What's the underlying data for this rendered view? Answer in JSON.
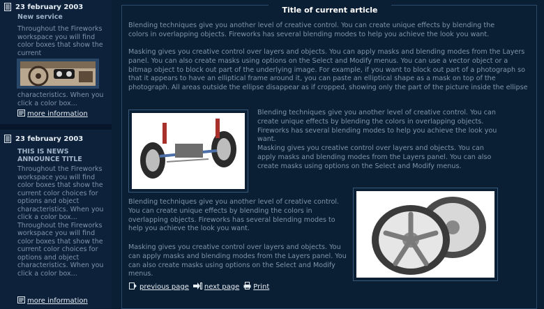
{
  "sidebar": {
    "news": [
      {
        "date": "23 february 2003",
        "title": "New service",
        "text_top": "Throughout the Fireworks workspace you will find color boxes that show the current",
        "text_bottom": "characteristics. When you click a color box...",
        "more_label": "more information"
      },
      {
        "date": "23 february 2003",
        "title": "THIS IS NEWS ANNOUNCE TITLE",
        "text": "Throughout the Fireworks workspace you will find color boxes that show the current color choices for options and object characteristics. When you click a color box... Throughout the Fireworks workspace you will find color boxes that show the current color choices for options and object characteristics. When you click a color box...",
        "more_label": "more information"
      }
    ]
  },
  "article": {
    "title": "Title of current article",
    "para1": "Blending techniques give you another level of creative control. You can create unique effects by blending the colors in overlapping objects. Fireworks has several blending modes to help you achieve the look you want.",
    "para2": "Masking gives you creative control over layers and objects. You can apply masks and blending modes from the Layers panel. You can also create masks using options on the Select and Modify menus. You can use a vector object or a bitmap object to block out part of the underlying image. For example, if you want to block out part of a photograph so that it appears to have an elliptical frame around it, you can paste an elliptical shape as a mask on top of the photograph. All areas outside the ellipse disappear as if cropped, showing only the part of the picture inside the ellipse",
    "para3": "Blending techniques give you another level of creative control. You can create unique effects by blending the colors in overlapping objects. Fireworks has several blending modes to help you achieve the look you want.",
    "para4": "Masking gives you creative control over layers and objects. You can apply masks and blending modes from the Layers panel. You can also create masks using options on the Select and Modify menus.",
    "para5": "Blending techniques give you another level of creative control. You can create unique effects by blending the colors in overlapping objects. Fireworks has several blending modes to help you achieve the look you want.",
    "para6": "Masking gives you creative control over layers and objects. You can apply masks and blending modes from the Layers panel. You can also create masks using options on the Select and Modify menus."
  },
  "nav": {
    "previous": "previous page",
    "next": "next page",
    "print": "Print"
  },
  "colors": {
    "background": "#0b1f34",
    "sidebar": "#0d223a",
    "text_muted": "#7f93a9",
    "text_bright": "#e8eef5",
    "border": "#2c4a6c"
  }
}
